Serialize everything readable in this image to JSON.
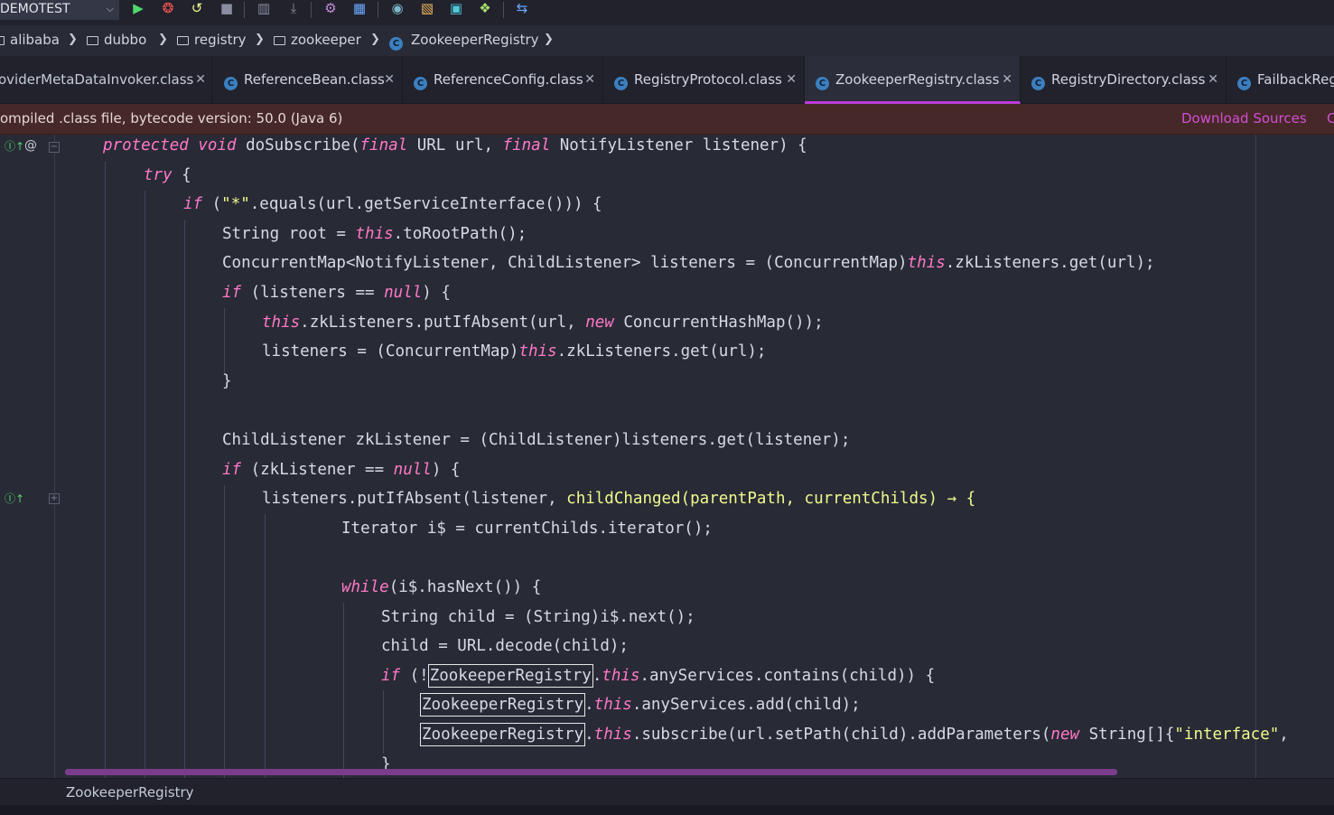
{
  "toolbar": {
    "run_config": "DEMOTEST",
    "icons": [
      "run-icon",
      "debug-icon",
      "coverage-icon",
      "stop-icon",
      "build-icon",
      "build-down-icon",
      "settings-icon",
      "structure-icon",
      "search-everywhere-icon",
      "layout-icon",
      "project-structure-icon",
      "plugin-icon",
      "sync-icon"
    ]
  },
  "breadcrumb": {
    "items": [
      "alibaba",
      "dubbo",
      "registry",
      "zookeeper",
      "ZookeeperRegistry"
    ]
  },
  "tabs": [
    {
      "label": "oviderMetaDataInvoker.class"
    },
    {
      "label": "ReferenceBean.class"
    },
    {
      "label": "ReferenceConfig.class"
    },
    {
      "label": "RegistryProtocol.class"
    },
    {
      "label": "ZookeeperRegistry.class",
      "active": true
    },
    {
      "label": "RegistryDirectory.class"
    },
    {
      "label": "FailbackReg"
    }
  ],
  "banner": {
    "text": "ompiled .class file, bytecode version: 50.0 (Java 6)",
    "download_sources": "Download Sources",
    "choose_sources": "C"
  },
  "editor": {
    "lines": [
      [
        [
          "kw",
          "protected"
        ],
        [
          "t",
          " "
        ],
        [
          "kw",
          "void"
        ],
        [
          "t",
          " doSubscribe("
        ],
        [
          "kw",
          "final"
        ],
        [
          "t",
          " URL url, "
        ],
        [
          "kw",
          "final"
        ],
        [
          "t",
          " NotifyListener listener) {"
        ]
      ],
      [
        [
          "kw",
          "try"
        ],
        [
          "t",
          " {"
        ]
      ],
      [
        [
          "kw",
          "if"
        ],
        [
          "t",
          " ("
        ],
        [
          "str",
          "\"*\""
        ],
        [
          "t",
          ".equals(url.getServiceInterface())) {"
        ]
      ],
      [
        [
          "t",
          "String root = "
        ],
        [
          "kw",
          "this"
        ],
        [
          "t",
          ".toRootPath();"
        ]
      ],
      [
        [
          "t",
          "ConcurrentMap<NotifyListener, ChildListener> listeners = (ConcurrentMap)"
        ],
        [
          "kw",
          "this"
        ],
        [
          "t",
          ".zkListeners.get(url);"
        ]
      ],
      [
        [
          "kw",
          "if"
        ],
        [
          "t",
          " (listeners == "
        ],
        [
          "kw",
          "null"
        ],
        [
          "t",
          ") {"
        ]
      ],
      [
        [
          "kw",
          "this"
        ],
        [
          "t",
          ".zkListeners.putIfAbsent(url, "
        ],
        [
          "kw",
          "new"
        ],
        [
          "t",
          " ConcurrentHashMap());"
        ]
      ],
      [
        [
          "t",
          "listeners = (ConcurrentMap)"
        ],
        [
          "kw",
          "this"
        ],
        [
          "t",
          ".zkListeners.get(url);"
        ]
      ],
      [
        [
          "t",
          "}"
        ]
      ],
      [
        [
          "t",
          ""
        ]
      ],
      [
        [
          "t",
          "ChildListener zkListener = (ChildListener)listeners.get(listener);"
        ]
      ],
      [
        [
          "kw",
          "if"
        ],
        [
          "t",
          " (zkListener == "
        ],
        [
          "kw",
          "null"
        ],
        [
          "t",
          ") {"
        ]
      ],
      [
        [
          "t",
          "listeners.putIfAbsent(listener, "
        ],
        [
          "lambda",
          "childChanged(parentPath, currentChilds) → {"
        ]
      ],
      [
        [
          "t",
          "Iterator i$ = currentChilds.iterator();"
        ]
      ],
      [
        [
          "t",
          ""
        ]
      ],
      [
        [
          "kw",
          "while"
        ],
        [
          "t",
          "(i$.hasNext()) {"
        ]
      ],
      [
        [
          "t",
          "String child = (String)i$.next();"
        ]
      ],
      [
        [
          "t",
          "child = URL.decode(child);"
        ]
      ],
      [
        [
          "kw",
          "if"
        ],
        [
          "t",
          " (!"
        ],
        [
          "box",
          "ZookeeperRegistry"
        ],
        [
          "t",
          "."
        ],
        [
          "kw",
          "this"
        ],
        [
          "t",
          ".anyServices.contains(child)) {"
        ]
      ],
      [
        [
          "box",
          "ZookeeperRegistry"
        ],
        [
          "t",
          "."
        ],
        [
          "kw",
          "this"
        ],
        [
          "t",
          ".anyServices.add(child);"
        ]
      ],
      [
        [
          "box",
          "ZookeeperRegistry"
        ],
        [
          "t",
          "."
        ],
        [
          "kw",
          "this"
        ],
        [
          "t",
          ".subscribe(url.setPath(child).addParameters("
        ],
        [
          "kw",
          "new"
        ],
        [
          "t",
          " String[]{"
        ],
        [
          "str",
          "\"interface\""
        ],
        [
          "t",
          ","
        ]
      ],
      [
        [
          "t",
          "}"
        ]
      ]
    ]
  },
  "status": {
    "breadcrumb": "ZookeeperRegistry"
  },
  "colors": {
    "background": "#282a36",
    "keyword": "#ff79c6",
    "string": "#f1fa8c",
    "accent": "#bd3ad8",
    "banner": "#462828"
  }
}
